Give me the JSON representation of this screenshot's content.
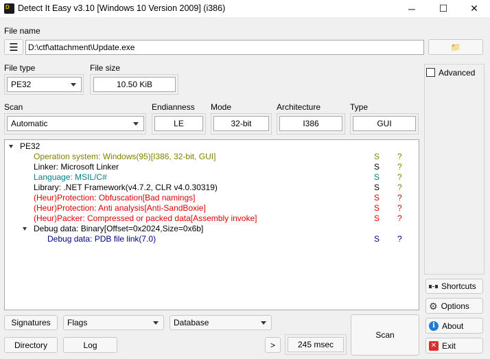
{
  "window": {
    "title": "Detect It Easy v3.10 [Windows 10 Version 2009] (i386)",
    "icon_text": "D",
    "minimize_glyph": "─",
    "maximize_glyph": "☐",
    "close_glyph": "✕"
  },
  "file_name": {
    "label": "File name",
    "path": "D:\\ctf\\attachment\\Update.exe",
    "menu_glyph": "☰",
    "browse_glyph": "📁"
  },
  "file_type": {
    "label": "File type",
    "value": "PE32"
  },
  "file_size": {
    "label": "File size",
    "value": "10.50 KiB"
  },
  "scan": {
    "label": "Scan",
    "value": "Automatic"
  },
  "endianness": {
    "label": "Endianness",
    "value": "LE"
  },
  "mode": {
    "label": "Mode",
    "value": "32-bit"
  },
  "architecture": {
    "label": "Architecture",
    "value": "I386"
  },
  "type": {
    "label": "Type",
    "value": "GUI"
  },
  "advanced": {
    "label": "Advanced",
    "checked": false
  },
  "results": {
    "root": "PE32",
    "rows": [
      {
        "text": "Operation system: Windows(95)[I386, 32-bit, GUI]",
        "s": "S",
        "q": "?",
        "color": "#808000"
      },
      {
        "text": "Linker: Microsoft Linker",
        "s": "S",
        "q": "?",
        "color": "#000000"
      },
      {
        "text": "Language: MSIL/C#",
        "s": "S",
        "q": "?",
        "color": "#008080"
      },
      {
        "text": "Library: .NET Framework(v4.7.2, CLR v4.0.30319)",
        "s": "S",
        "q": "?",
        "color": "#000000"
      },
      {
        "text": "(Heur)Protection: Obfuscation[Bad namings]",
        "s": "S",
        "q": "?",
        "color": "#e00000"
      },
      {
        "text": "(Heur)Protection: Anti analysis[Anti-SandBoxie]",
        "s": "S",
        "q": "?",
        "color": "#e00000"
      },
      {
        "text": "(Heur)Packer: Compressed or packed data[Assembly invoke]",
        "s": "S",
        "q": "?",
        "color": "#e00000"
      },
      {
        "text": "Debug data: Binary[Offset=0x2024,Size=0x6b]",
        "s": "",
        "q": "",
        "color": "#000000"
      },
      {
        "text": "Debug data: PDB file link(7.0)",
        "s": "S",
        "q": "?",
        "color": "#000080"
      }
    ]
  },
  "side": {
    "shortcuts": "Shortcuts",
    "options": "Options",
    "about": "About",
    "exit": "Exit"
  },
  "bottom": {
    "signatures": "Signatures",
    "flags": "Flags",
    "database": "Database",
    "directory": "Directory",
    "log": "Log",
    "more": ">",
    "time": "245 msec",
    "scan": "Scan"
  },
  "colors": {
    "olive": "#808000",
    "teal": "#008080",
    "red": "#e00000",
    "navy": "#000080",
    "question": "#808000"
  }
}
